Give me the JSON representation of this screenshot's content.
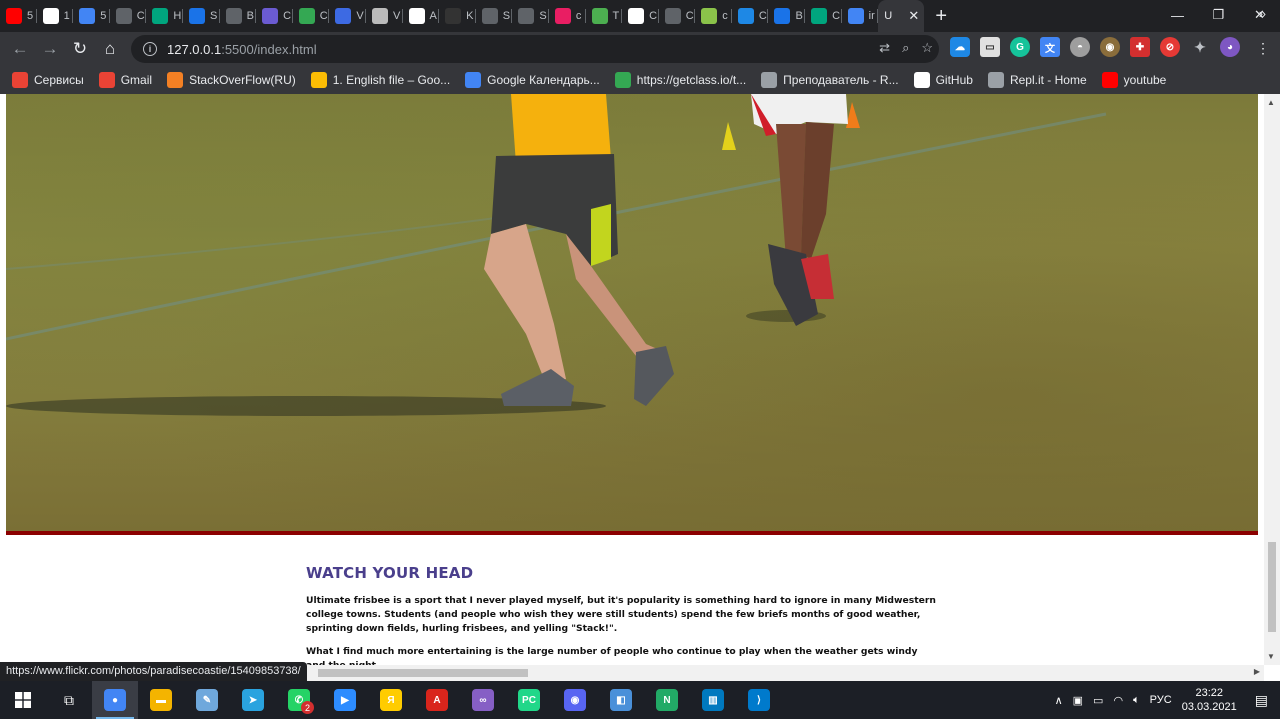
{
  "tabs": [
    {
      "label": "5",
      "color": "#ff0000",
      "icon": "youtube-icon"
    },
    {
      "label": "1",
      "color": "#ffffff",
      "icon": "page-icon"
    },
    {
      "label": "5",
      "color": "#4285f4",
      "icon": "google-icon"
    },
    {
      "label": "C",
      "color": "#5f6368",
      "icon": "code-icon"
    },
    {
      "label": "H",
      "color": "#00a67e",
      "icon": "w-icon"
    },
    {
      "label": "S",
      "color": "#1a73e8",
      "icon": "doc-icon"
    },
    {
      "label": "B",
      "color": "#5f6368",
      "icon": "code-icon"
    },
    {
      "label": "C",
      "color": "#6b5bd2",
      "icon": "purple-icon"
    },
    {
      "label": "C",
      "color": "#34a853",
      "icon": "circle-icon"
    },
    {
      "label": "V",
      "color": "#3d6ae3",
      "icon": "w-icon"
    },
    {
      "label": "V",
      "color": "#bbbbbb",
      "icon": "gear-icon"
    },
    {
      "label": "A",
      "color": "#ffffff",
      "icon": "box-icon"
    },
    {
      "label": "K",
      "color": "#333333",
      "icon": "f-icon"
    },
    {
      "label": "S",
      "color": "#5f6368",
      "icon": "code-icon"
    },
    {
      "label": "S",
      "color": "#5f6368",
      "icon": "code-icon"
    },
    {
      "label": "c",
      "color": "#e91e63",
      "icon": "asterisk-icon"
    },
    {
      "label": "T",
      "color": "#4caf50",
      "icon": "leaf-icon"
    },
    {
      "label": "C",
      "color": "#ffffff",
      "icon": "box-icon"
    },
    {
      "label": "C",
      "color": "#5f6368",
      "icon": "code-icon"
    },
    {
      "label": "c",
      "color": "#8bc34a",
      "icon": "avatar-icon"
    },
    {
      "label": "C",
      "color": "#1e88e5",
      "icon": "css-icon"
    },
    {
      "label": "B",
      "color": "#1a73e8",
      "icon": "c-icon"
    },
    {
      "label": "C",
      "color": "#00a67e",
      "icon": "w-icon"
    },
    {
      "label": "ir",
      "color": "#4285f4",
      "icon": "google-icon"
    }
  ],
  "active_tab": {
    "label": "U"
  },
  "address": {
    "host": "127.0.0.1",
    "path": ":5500/index.html"
  },
  "bookmarks": [
    {
      "label": "Сервисы",
      "color": "#ea4335",
      "icon": "apps-grid-icon"
    },
    {
      "label": "Gmail",
      "color": "#ea4335",
      "icon": "gmail-icon"
    },
    {
      "label": "StackOverFlow(RU)",
      "color": "#f48024",
      "icon": "stackoverflow-icon"
    },
    {
      "label": "1. English file – Goo...",
      "color": "#fbbc04",
      "icon": "drive-icon"
    },
    {
      "label": "Google Календарь...",
      "color": "#4285f4",
      "icon": "calendar-icon"
    },
    {
      "label": "https://getclass.io/t...",
      "color": "#34a853",
      "icon": "g-icon"
    },
    {
      "label": "Преподаватель - R...",
      "color": "#9aa0a6",
      "icon": "globe-icon"
    },
    {
      "label": "GitHub",
      "color": "#ffffff",
      "icon": "github-icon"
    },
    {
      "label": "Repl.it - Home",
      "color": "#9aa0a6",
      "icon": "replit-icon"
    },
    {
      "label": "youtube",
      "color": "#ff0000",
      "icon": "youtube-icon"
    }
  ],
  "article": {
    "heading": "WATCH YOUR HEAD",
    "p1": "Ultimate frisbee is a sport that I never played myself, but it's popularity is something hard to ignore in many Midwestern college towns. Students (and people who wish they were still students) spend the few briefs months of good weather, sprinting down fields, hurling frisbees, and yelling \"Stack!\".",
    "p2": "What I find much more entertaining is the large number of people who continue to play when the weather gets windy and the night"
  },
  "status_url": "https://www.flickr.com/photos/paradisecoastie/15409853738/",
  "taskbar": {
    "apps": [
      {
        "name": "chrome",
        "color": "#4285f4",
        "glyph": "●"
      },
      {
        "name": "explorer",
        "color": "#f4b400",
        "glyph": "▬"
      },
      {
        "name": "notes",
        "color": "#6fa8dc",
        "glyph": "✎"
      },
      {
        "name": "telegram",
        "color": "#2aa3df",
        "glyph": "➤"
      },
      {
        "name": "whatsapp",
        "color": "#25d366",
        "glyph": "✆"
      },
      {
        "name": "zoom",
        "color": "#2d8cff",
        "glyph": "▶"
      },
      {
        "name": "yandex",
        "color": "#ffcc00",
        "glyph": "Я"
      },
      {
        "name": "acrobat",
        "color": "#d9251c",
        "glyph": "A"
      },
      {
        "name": "visual-studio",
        "color": "#865fc5",
        "glyph": "∞"
      },
      {
        "name": "pycharm",
        "color": "#21d789",
        "glyph": "PC"
      },
      {
        "name": "discord",
        "color": "#5865f2",
        "glyph": "◉"
      },
      {
        "name": "notepad",
        "color": "#4a90d9",
        "glyph": "◧"
      },
      {
        "name": "nox",
        "color": "#22aa66",
        "glyph": "N"
      },
      {
        "name": "trello",
        "color": "#0079bf",
        "glyph": "▥"
      },
      {
        "name": "vscode",
        "color": "#007acc",
        "glyph": "⟩"
      }
    ],
    "whatsapp_badge": "2",
    "lang": "РУС",
    "time": "23:22",
    "date": "03.03.2021"
  }
}
